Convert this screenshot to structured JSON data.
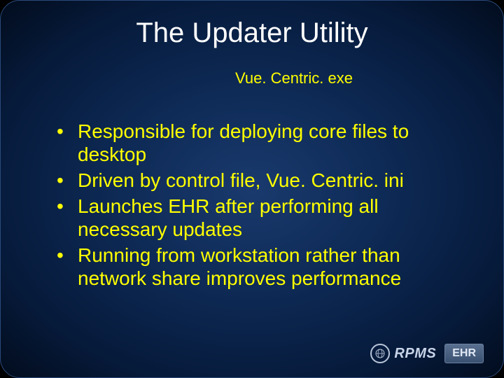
{
  "title": "The Updater Utility",
  "subtitle": "Vue. Centric. exe",
  "bullets": [
    "Responsible for deploying core files to desktop",
    "Driven by control file, Vue. Centric. ini",
    "Launches EHR after performing all necessary updates",
    "Running from workstation rather than network share improves performance"
  ],
  "logo": {
    "rpms_icon": "⊕",
    "rpms_text": "RPMS",
    "ehr_text": "EHR"
  }
}
